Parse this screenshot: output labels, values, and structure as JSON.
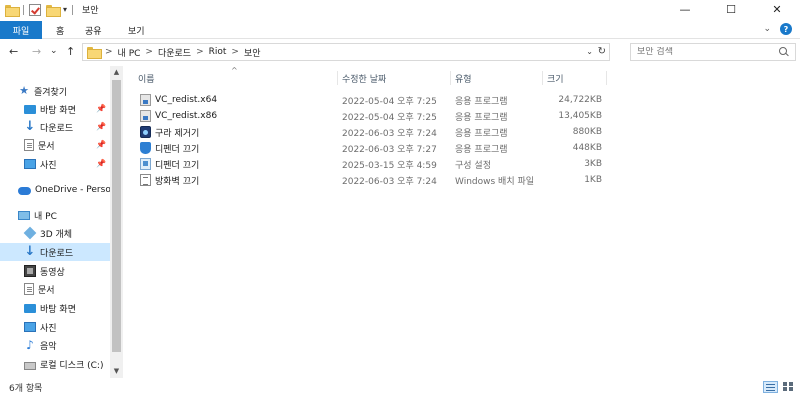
{
  "window": {
    "title": "보안",
    "controls": {
      "minimize": "—",
      "maximize": "☐",
      "close": "✕"
    }
  },
  "ribbon": {
    "file_tab": "파일",
    "tabs": [
      "홈",
      "공유",
      "보기"
    ],
    "expand_glyph": "⌄",
    "help_glyph": "?"
  },
  "nav": {
    "back": "←",
    "forward": "→",
    "recent": "⌄",
    "up": "↑",
    "breadcrumbs": [
      "내 PC",
      "다운로드",
      "Riot",
      "보안"
    ],
    "crumb_sep": ">",
    "dropdown": "⌄",
    "refresh": "↻",
    "search_placeholder": "보안 검색"
  },
  "sidebar": {
    "items": [
      {
        "label": "즐겨찾기",
        "icon": "star-icon",
        "pinned": false
      },
      {
        "label": "바탕 화면",
        "icon": "desktop-icon",
        "pinned": true
      },
      {
        "label": "다운로드",
        "icon": "download-icon",
        "pinned": true
      },
      {
        "label": "문서",
        "icon": "document-icon",
        "pinned": true
      },
      {
        "label": "사진",
        "icon": "pictures-icon",
        "pinned": true
      },
      {
        "label": "OneDrive - Person",
        "icon": "onedrive-icon",
        "pinned": false
      },
      {
        "label": "내 PC",
        "icon": "this-pc-icon",
        "pinned": false
      },
      {
        "label": "3D 개체",
        "icon": "3d-objects-icon",
        "pinned": false
      },
      {
        "label": "다운로드",
        "icon": "download-icon",
        "pinned": false,
        "selected": true
      },
      {
        "label": "동영상",
        "icon": "video-icon",
        "pinned": false
      },
      {
        "label": "문서",
        "icon": "document-icon",
        "pinned": false
      },
      {
        "label": "바탕 화면",
        "icon": "desktop-icon",
        "pinned": false
      },
      {
        "label": "사진",
        "icon": "pictures-icon",
        "pinned": false
      },
      {
        "label": "음악",
        "icon": "music-icon",
        "pinned": false
      },
      {
        "label": "로컬 디스크 (C:)",
        "icon": "drive-icon",
        "pinned": false
      }
    ],
    "scroll_up": "▲",
    "scroll_down": "▼"
  },
  "columns": {
    "name": "이름",
    "date": "수정한 날짜",
    "type": "유형",
    "size": "크기",
    "sort_indicator": "^"
  },
  "files": [
    {
      "name": "VC_redist.x64",
      "date": "2022-05-04 오후 7:25",
      "type": "응용 프로그램",
      "size": "24,722KB",
      "icon": "installer-icon"
    },
    {
      "name": "VC_redist.x86",
      "date": "2022-05-04 오후 7:25",
      "type": "응용 프로그램",
      "size": "13,405KB",
      "icon": "installer-icon"
    },
    {
      "name": "구라 제거기",
      "date": "2022-06-03 오후 7:24",
      "type": "응용 프로그램",
      "size": "880KB",
      "icon": "app-icon"
    },
    {
      "name": "디펜더 끄기",
      "date": "2022-06-03 오후 7:27",
      "type": "응용 프로그램",
      "size": "448KB",
      "icon": "shield-icon"
    },
    {
      "name": "디펜더 끄기",
      "date": "2025-03-15 오후 4:59",
      "type": "구성 설정",
      "size": "3KB",
      "icon": "settings-file-icon"
    },
    {
      "name": "방화벽 끄기",
      "date": "2022-06-03 오후 7:24",
      "type": "Windows 배치 파일",
      "size": "1KB",
      "icon": "batch-file-icon"
    }
  ],
  "status": {
    "item_count": "6개 항목"
  }
}
